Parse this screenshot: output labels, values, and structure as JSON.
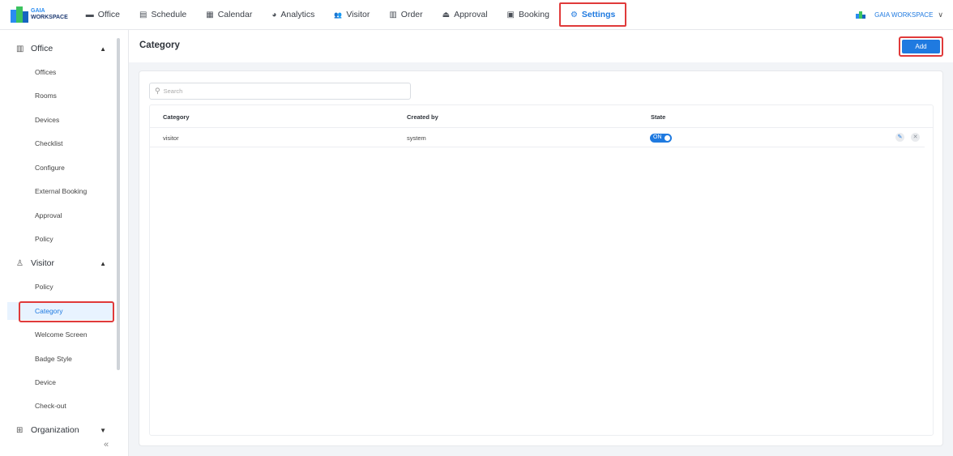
{
  "brand": {
    "line1": "GAIA",
    "line2": "WORKSPACE"
  },
  "nav": [
    {
      "label": "Office",
      "icon": "briefcase-icon",
      "glyph": "▬"
    },
    {
      "label": "Schedule",
      "icon": "schedule-icon",
      "glyph": "▤"
    },
    {
      "label": "Calendar",
      "icon": "calendar-icon",
      "glyph": "▦"
    },
    {
      "label": "Analytics",
      "icon": "pie-chart-icon",
      "glyph": "◕"
    },
    {
      "label": "Visitor",
      "icon": "users-icon",
      "glyph": "👥"
    },
    {
      "label": "Order",
      "icon": "order-icon",
      "glyph": "▥"
    },
    {
      "label": "Approval",
      "icon": "approval-icon",
      "glyph": "⏏"
    },
    {
      "label": "Booking",
      "icon": "booking-icon",
      "glyph": "▣"
    },
    {
      "label": "Settings",
      "icon": "gear-icon",
      "glyph": "⚙"
    }
  ],
  "workspace": {
    "label": "GAIA WORKSPACE",
    "chevron": "∨"
  },
  "sidebar": {
    "groups": [
      {
        "label": "Office",
        "icon": "building-icon",
        "glyph": "▥",
        "chevron": "▲"
      },
      {
        "label": "Visitor",
        "icon": "visitor-icon",
        "glyph": "♙",
        "chevron": "▲"
      },
      {
        "label": "Organization",
        "icon": "org-chart-icon",
        "glyph": "⊞",
        "chevron": "▼"
      }
    ],
    "office_items": [
      "Offices",
      "Rooms",
      "Devices",
      "Checklist",
      "Configure",
      "External Booking",
      "Approval",
      "Policy"
    ],
    "visitor_items": [
      "Policy",
      "Category",
      "Welcome Screen",
      "Badge Style",
      "Device",
      "Check-out"
    ],
    "active_item": "Category",
    "collapse_glyph": "«"
  },
  "page": {
    "title": "Category",
    "add_label": "Add"
  },
  "search": {
    "placeholder": "Search",
    "glyph": "⚲"
  },
  "table": {
    "columns": [
      "Category",
      "Created by",
      "State"
    ],
    "rows": [
      {
        "category": "visitor",
        "created_by": "system",
        "state": "ON"
      }
    ],
    "edit_glyph": "✎",
    "delete_glyph": "✕"
  },
  "colors": {
    "accent": "#1f7ae0",
    "highlight": "#e03a3a",
    "active_bg": "#e8f3ff"
  }
}
